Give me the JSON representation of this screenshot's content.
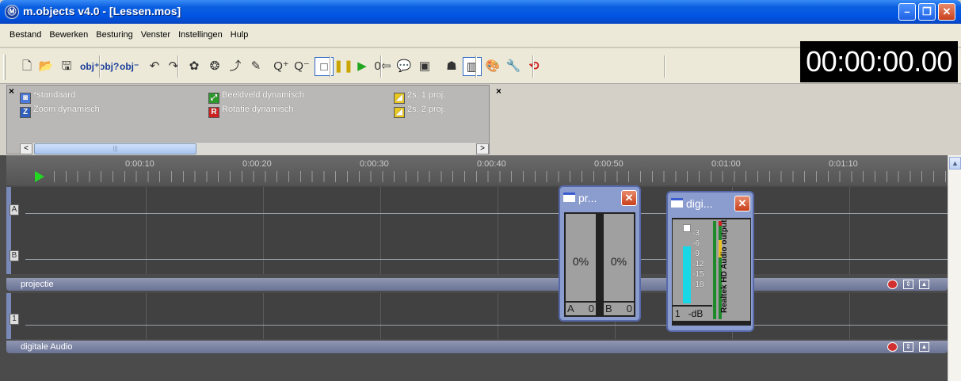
{
  "window": {
    "title": "m.objects v4.0 - [Lessen.mos]",
    "icon_name": "mobjects-app-icon",
    "min_label": "–",
    "max_label": "❐",
    "close_label": "✕"
  },
  "menu": [
    "Bestand",
    "Bewerken",
    "Besturing",
    "Venster",
    "Instellingen",
    "Hulp"
  ],
  "toolbar": {
    "buttons": [
      {
        "name": "new-icon",
        "glyph": "🗋"
      },
      {
        "name": "open-folder-icon",
        "glyph": "📂"
      },
      {
        "name": "save-icon",
        "glyph": "🖫"
      },
      {
        "name": "obj-add-icon",
        "glyph": "obj⁺"
      },
      {
        "name": "obj-query-icon",
        "glyph": "obj?"
      },
      {
        "name": "obj-minus-icon",
        "glyph": "obj⁻"
      },
      {
        "name": "undo-icon",
        "glyph": "↶"
      },
      {
        "name": "redo-icon",
        "glyph": "↷"
      },
      {
        "name": "color-wheel-icon",
        "glyph": "✿"
      },
      {
        "name": "color-rotate-icon",
        "glyph": "❂"
      },
      {
        "name": "pick-tool-icon",
        "glyph": "⤴"
      },
      {
        "name": "pen-tool-icon",
        "glyph": "✎"
      },
      {
        "name": "zoom-in-icon",
        "glyph": "Q⁺"
      },
      {
        "name": "zoom-out-icon",
        "glyph": "Q⁻"
      },
      {
        "name": "stop-icon",
        "glyph": "□"
      },
      {
        "name": "pause-icon",
        "glyph": "❚❚"
      },
      {
        "name": "play-icon",
        "glyph": "▶"
      },
      {
        "name": "zero-position-icon",
        "glyph": "0⇦"
      },
      {
        "name": "comment-icon",
        "glyph": "💬"
      },
      {
        "name": "image-icon",
        "glyph": "▣"
      },
      {
        "name": "projector-icon",
        "glyph": "☗"
      },
      {
        "name": "meter-icon",
        "glyph": "▥"
      },
      {
        "name": "paint-icon",
        "glyph": "🎨"
      },
      {
        "name": "wrench-icon",
        "glyph": "🔧"
      },
      {
        "name": "magnet-icon",
        "glyph": "⟲"
      }
    ],
    "timecode": "00:00:00.00"
  },
  "effects": {
    "col1": [
      {
        "label": "*standaard",
        "icon": "standaard-icon",
        "glyph": "◙",
        "color": "#4a7be0"
      },
      {
        "label": "Zoom dynamisch",
        "icon": "zoom-dynamic-icon",
        "glyph": "Z",
        "color": "#3060c0"
      }
    ],
    "col2": [
      {
        "label": "Beeldveld dynamisch",
        "icon": "image-field-dynamic-icon",
        "glyph": "⤢",
        "color": "#2a9a2a"
      },
      {
        "label": "Rotatie dynamisch",
        "icon": "rotation-dynamic-icon",
        "glyph": "R",
        "color": "#d02020"
      }
    ],
    "col3": [
      {
        "label": "2s, 1 proj.",
        "icon": "fade-1-proj-icon",
        "glyph": "◢",
        "color": "#e8c820"
      },
      {
        "label": "2s, 2 proj.",
        "icon": "fade-2-proj-icon",
        "glyph": "◢",
        "color": "#e8c820"
      }
    ],
    "close_label": "×",
    "scroll_left": "<",
    "scroll_right": ">",
    "thumb": "|||"
  },
  "timeline": {
    "ticks": [
      "0:00:10",
      "0:00:20",
      "0:00:30",
      "0:00:40",
      "0:00:50",
      "0:01:00",
      "0:01:10"
    ],
    "tracks": [
      {
        "name": "projectie",
        "lanes": [
          "A",
          "B"
        ]
      },
      {
        "name": "digitale Audio",
        "lanes": [
          "1"
        ]
      }
    ]
  },
  "projection_window": {
    "title": "pr...",
    "a_pct": "0%",
    "b_pct": "0%",
    "a_label": "A",
    "a_value": "0",
    "b_label": "B",
    "b_value": "0"
  },
  "audio_window": {
    "title": "digi...",
    "scale": [
      "-3",
      "-6",
      "-9",
      "-12",
      "-15",
      "-18"
    ],
    "channel": "1",
    "unit": "-dB",
    "device": "Realtek HD Audio output",
    "level": 0.72,
    "colors": {
      "level": "#19d8e6",
      "peak_yellow": "#e8c020",
      "peak_red": "#d02020",
      "meter_green": "#1f8a2a"
    }
  }
}
